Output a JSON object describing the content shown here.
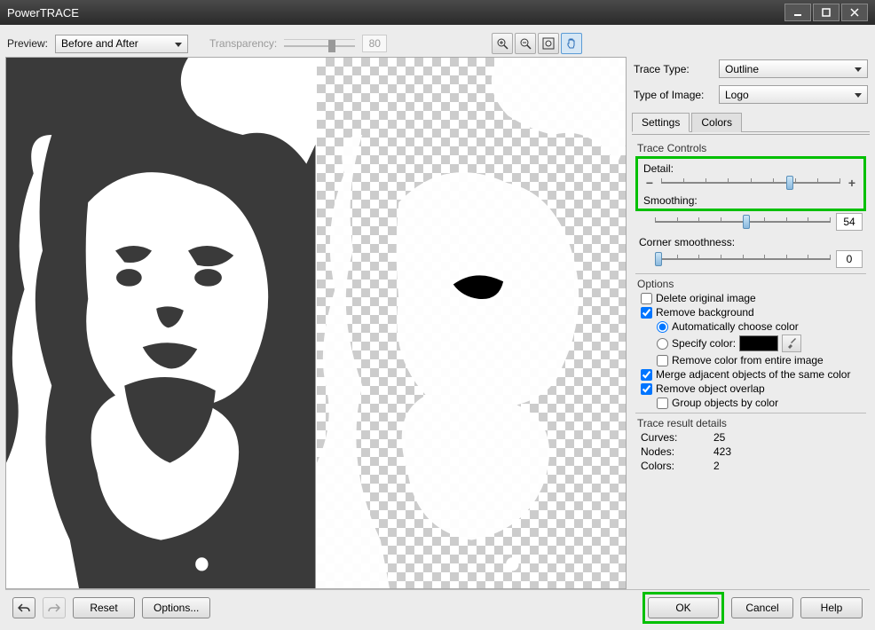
{
  "window": {
    "title": "PowerTRACE"
  },
  "toolbar": {
    "preview_label": "Preview:",
    "preview_value": "Before and After",
    "transparency_label": "Transparency:",
    "transparency_value": "80"
  },
  "side": {
    "trace_type_label": "Trace Type:",
    "trace_type_value": "Outline",
    "type_of_image_label": "Type of Image:",
    "type_of_image_value": "Logo",
    "tabs": {
      "settings": "Settings",
      "colors": "Colors"
    },
    "trace_controls_title": "Trace Controls",
    "detail_label": "Detail:",
    "smoothing_label": "Smoothing:",
    "smoothing_value": "54",
    "corner_label": "Corner smoothness:",
    "corner_value": "0",
    "options_title": "Options",
    "delete_original_label": "Delete original image",
    "remove_bg_label": "Remove background",
    "auto_color_label": "Automatically choose color",
    "specify_color_label": "Specify color:",
    "remove_color_entire_label": "Remove color from entire image",
    "merge_adjacent_label": "Merge adjacent objects of the same color",
    "remove_overlap_label": "Remove object overlap",
    "group_by_color_label": "Group objects by color",
    "results_title": "Trace result details",
    "curves_label": "Curves:",
    "curves_value": "25",
    "nodes_label": "Nodes:",
    "nodes_value": "423",
    "colors_label": "Colors:",
    "colors_value": "2"
  },
  "footer": {
    "reset": "Reset",
    "options": "Options...",
    "ok": "OK",
    "cancel": "Cancel",
    "help": "Help"
  }
}
